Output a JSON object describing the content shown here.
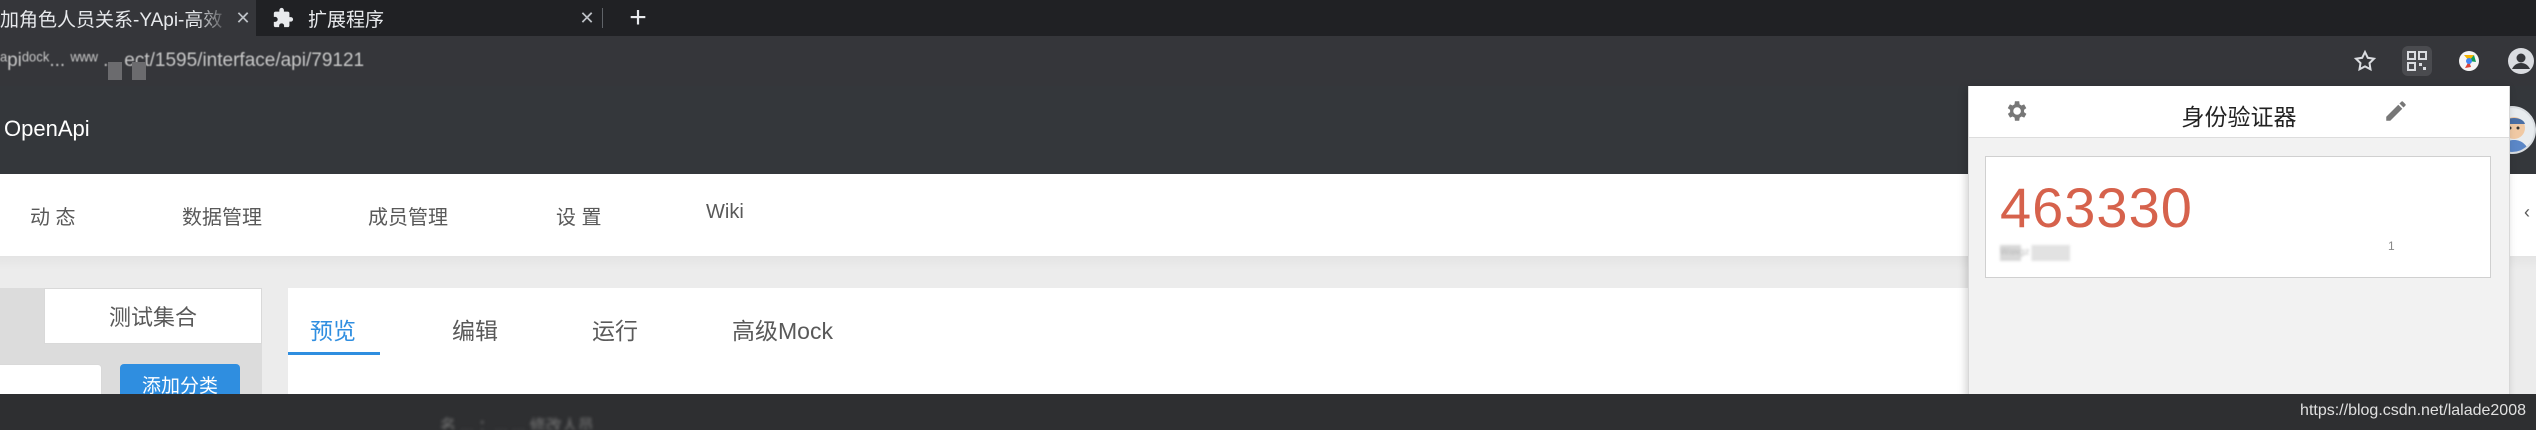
{
  "browser": {
    "tabs": [
      {
        "title": "加角色人员关系-YApi-高效",
        "close": "✕",
        "active": true
      },
      {
        "title": "扩展程序",
        "close": "✕",
        "active": false
      }
    ],
    "new_tab": "+",
    "url": "ᵃpiᵈᵒᶜᵏ... ʷʷʷ ... ect/1595/interface/api/79121",
    "icons": [
      "star-icon",
      "qr-icon",
      "extension-icon",
      "account-icon"
    ]
  },
  "app": {
    "brand": "OpenApi",
    "help": "?"
  },
  "project_nav": {
    "items": [
      "动 态",
      "数据管理",
      "成员管理",
      "设 置",
      "Wiki"
    ],
    "more": "‹"
  },
  "left_panel": {
    "tab": "测试集合",
    "add_category": "添加分类"
  },
  "interface_tabs": [
    "预览",
    "编辑",
    "运行",
    "高级Mock"
  ],
  "authenticator": {
    "title": "身份验证器",
    "code": "463330",
    "issuer": "ᵂᵃᶰᵍᶻ",
    "mark": "1"
  },
  "footer": {
    "blurred": "名 ... ：... ... 修改人员",
    "watermark": "https://blog.csdn.net/lalade2008"
  },
  "colors": {
    "accent": "#2f8ee0",
    "code": "#d6624c",
    "header": "#34373b"
  }
}
